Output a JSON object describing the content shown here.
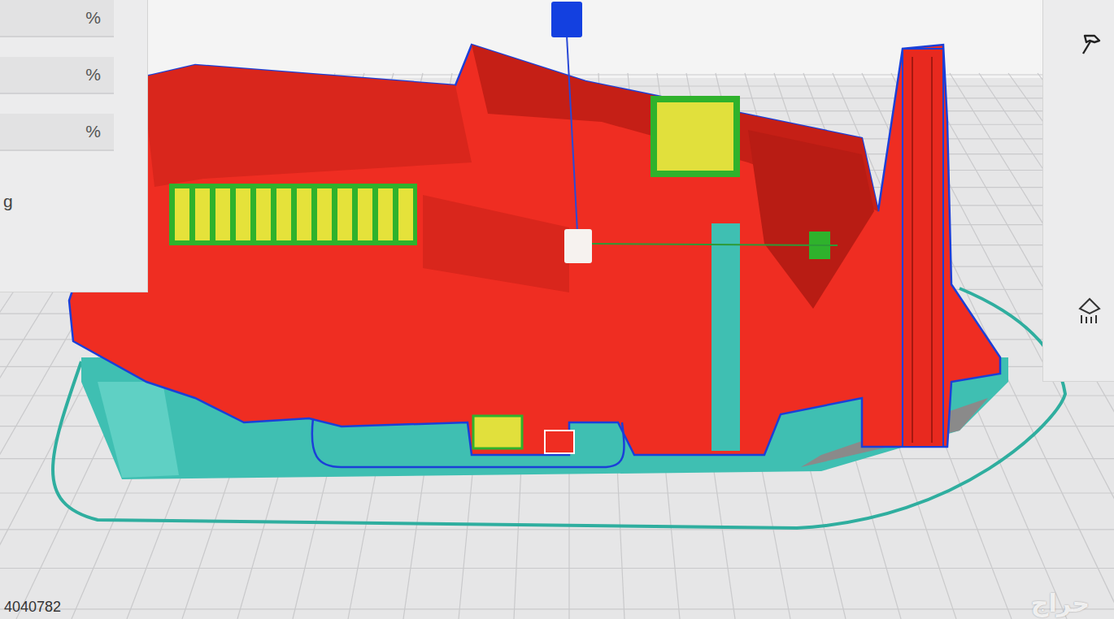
{
  "settings_panel": {
    "rows": [
      {
        "unit": "%"
      },
      {
        "unit": "%"
      },
      {
        "unit": "%"
      }
    ],
    "partial_label": "g"
  },
  "footer": {
    "code": "4040782"
  },
  "watermark": "حراج"
}
